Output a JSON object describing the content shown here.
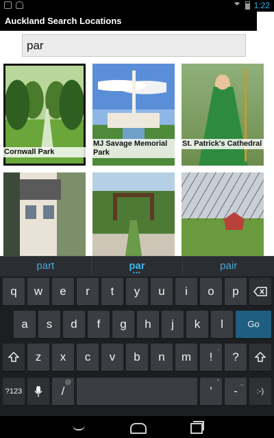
{
  "status_bar": {
    "time": "1:22",
    "icons": [
      "notification-icon",
      "android-icon",
      "wifi-icon",
      "battery-icon"
    ]
  },
  "app": {
    "title": "Auckland Search Locations",
    "search": {
      "value": "par"
    }
  },
  "results": [
    {
      "label": "Cornwall Park"
    },
    {
      "label": "MJ Savage Memorial Park"
    },
    {
      "label": "St. Patrick's Cathedral"
    },
    {
      "label": ""
    },
    {
      "label": ""
    },
    {
      "label": ""
    }
  ],
  "suggestions": [
    "part",
    "par",
    "pair"
  ],
  "keyboard": {
    "row1": [
      "q",
      "w",
      "e",
      "r",
      "t",
      "y",
      "u",
      "i",
      "o",
      "p"
    ],
    "row2": [
      "a",
      "s",
      "d",
      "f",
      "g",
      "h",
      "j",
      "k",
      "l"
    ],
    "row3": [
      "z",
      "x",
      "c",
      "v",
      "b",
      "n",
      "m",
      "!",
      "?"
    ],
    "row3_hints": [
      ",",
      "."
    ],
    "go": "Go",
    "sym": "?123",
    "slash": "/",
    "slash_hint": "@",
    "apostrophe": "'",
    "apostrophe_hint": "\"",
    "dash": "-",
    "dash_hint": "_",
    "smiley": ":-)"
  },
  "colors": {
    "accent": "#33b5e5",
    "go_key": "#1f5e80",
    "keyboard_bg": "#1c1e21"
  }
}
